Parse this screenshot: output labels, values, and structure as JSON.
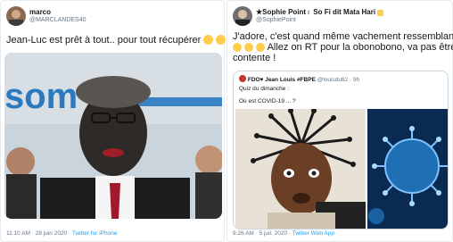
{
  "left_tweet": {
    "display_name": "marco",
    "handle": "@MARCLANDES40",
    "text": "Jean-Luc est prêt à tout.. pour tout récupérer",
    "time_date": "11:10 AM · 28 juin 2020",
    "source": "Twitter for iPhone",
    "media_text": "som"
  },
  "right_tweet": {
    "display_name": "★Sophie Point♁ So Fi dit Mata Hari",
    "handle": "@SophiePoint",
    "text_line1": "J'adore, c'est quand même vachement ressemblant !",
    "text_line2": "Allez on RT pour la obonobono, va pas être",
    "text_line3": "contente !",
    "time_date": "9:26 AM · 5 juil. 2020",
    "source": "Twitter Web App",
    "quote": {
      "display_name": "FDO♥ Jean Louis #FBPE",
      "handle": "@louisdu82 · 9h",
      "line1": "Quiz du dimanche :",
      "line2": "Où est COVID-19 ... ?"
    }
  },
  "colors": {
    "link": "#1da1f2",
    "muted": "#657786",
    "border": "#e6ecf0"
  }
}
